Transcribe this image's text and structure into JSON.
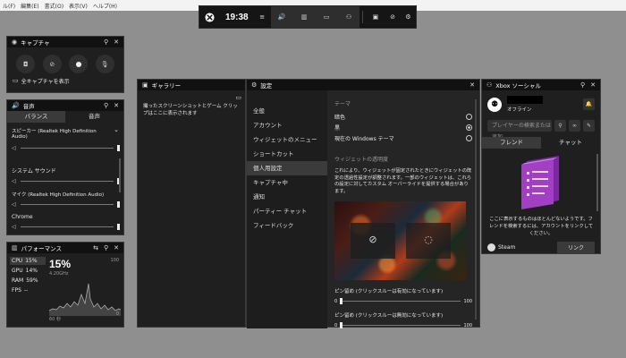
{
  "background": {
    "menu": [
      "ル(F)",
      "編集(E)",
      "書式(O)",
      "表示(V)",
      "ヘルプ(H)"
    ]
  },
  "gamebar": {
    "time": "19:38"
  },
  "capture": {
    "title": "キャプチャ",
    "show_all": "全キャプチャを表示"
  },
  "audio": {
    "title": "音声",
    "tab_mix": "バランス",
    "tab_voice": "音声",
    "device": "スピーカー (Realtek High Definition Audio)",
    "system_sound": "システム サウンド",
    "mic": "マイク (Realtek High Definition Audio)",
    "chrome": "Chrome"
  },
  "performance": {
    "title": "パフォーマンス",
    "cpu_label": "CPU",
    "cpu_value": "15%",
    "gpu_label": "GPU",
    "gpu_value": "14%",
    "ram_label": "RAM",
    "ram_value": "59%",
    "fps_label": "FPS",
    "fps_value": "--",
    "big_value": "15%",
    "freq": "4.20GHz",
    "axis_max": "100",
    "axis_min": "0",
    "time_label": "60 秒"
  },
  "gallery": {
    "title": "ギャラリー",
    "empty_text": "撮ったスクリーンショットとゲーム クリップはここに表示されます"
  },
  "settings": {
    "title": "設定",
    "nav": [
      "全般",
      "アカウント",
      "ウィジェットのメニュー",
      "ショートカット",
      "個人用設定",
      "キャプチャ中",
      "通知",
      "パーティー チャット",
      "フィードバック"
    ],
    "theme_heading": "テーマ",
    "theme_options": [
      "暗色",
      "黒",
      "現在の Windows テーマ"
    ],
    "transparency_heading": "ウィジェットの透明度",
    "transparency_desc": "これにより、ウィジェットが固定されたときにウィジェットの既定の透過性設定が調整されます。一部のウィジェットは、これらの設定に対してカスタム オーバーライドを提供する場合があります。",
    "pin_on_label": "ピン留め (クリックスルーは有効になっています)",
    "pin_off_label": "ピン留め (クリックスルーは無効になっています)",
    "slider_min": "0",
    "slider_max": "100"
  },
  "xbox": {
    "title": "Xbox ソーシャル",
    "status": "オフライン",
    "search_placeholder": "プレイヤーの検索または追加",
    "tab_friends": "フレンド",
    "tab_chat": "チャット",
    "empty_text": "ここに表示するものはほとんどないようです。フレンドを検索するには、アカウントをリンクしてください。",
    "steam_label": "Steam",
    "link_button": "リンク"
  },
  "colors": {
    "accent": "#a23fc4",
    "panel": "#1f1f1f",
    "titlebar": "#111111"
  }
}
